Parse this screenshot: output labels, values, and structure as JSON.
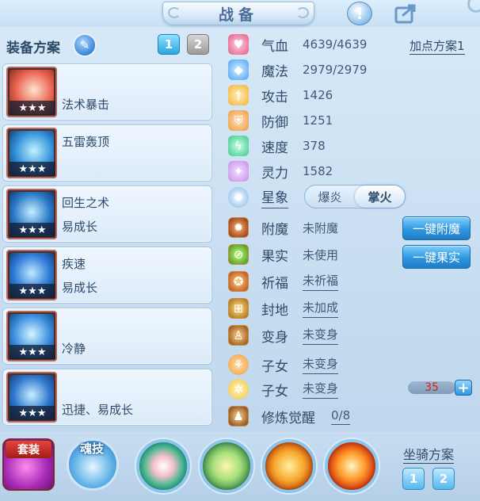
{
  "header": {
    "title": "战备",
    "help_icon": "exclamation-icon",
    "share_icon": "share-icon"
  },
  "equip_plan": {
    "label": "装备方案",
    "tabs": [
      "1",
      "2"
    ],
    "active_tab": "1",
    "items": [
      {
        "skill1": "",
        "skill2": "法术暴击",
        "stars": "★★★",
        "color": "#6fcf5a"
      },
      {
        "skill1": "五雷轰顶",
        "skill2": "",
        "stars": "★★★",
        "color": "#3a7fd8"
      },
      {
        "skill1": "回生之术",
        "skill2": "易成长",
        "stars": "★★★",
        "color": "#2f6fc2"
      },
      {
        "skill1": "疾速",
        "skill2": "易成长",
        "stars": "★★★",
        "color": "#2d7ad8"
      },
      {
        "skill1": "",
        "skill2": "冷静",
        "stars": "★★★",
        "color": "#3a8fe0"
      },
      {
        "skill1": "",
        "skill2": "迅捷、易成长",
        "stars": "★★★",
        "color": "#2f78cf"
      }
    ]
  },
  "stats": {
    "add_point_plan": "加点方案1",
    "rows": [
      {
        "name": "气血",
        "value": "4639/4639",
        "icon": "heart-icon",
        "color": "#e25a86"
      },
      {
        "name": "魔法",
        "value": "2979/2979",
        "icon": "mana-icon",
        "color": "#4aa3f0"
      },
      {
        "name": "攻击",
        "value": "1426",
        "icon": "sword-icon",
        "color": "#f2b233"
      },
      {
        "name": "防御",
        "value": "1251",
        "icon": "shield-icon",
        "color": "#ef9a3c"
      },
      {
        "name": "速度",
        "value": "378",
        "icon": "speed-icon",
        "color": "#3cc88a"
      },
      {
        "name": "灵力",
        "value": "1582",
        "icon": "spirit-icon",
        "color": "#c58de6"
      }
    ],
    "star_sign": {
      "name": "星象",
      "options": [
        "爆炎",
        "掌火"
      ],
      "selected": "掌火"
    },
    "extras": [
      {
        "name": "附魔",
        "value": "未附魔",
        "icon": "enchant-icon",
        "button": "一键附魔"
      },
      {
        "name": "果实",
        "value": "未使用",
        "icon": "fruit-icon",
        "button": "一键果实"
      },
      {
        "name": "祈福",
        "value": "未祈福",
        "icon": "blessing-icon"
      },
      {
        "name": "封地",
        "value": "未加成",
        "icon": "fief-icon"
      },
      {
        "name": "变身",
        "value": "未变身",
        "icon": "transform-icon"
      },
      {
        "name": "子女",
        "value": "未变身",
        "icon": "child-icon"
      },
      {
        "name": "子女",
        "value": "未变身",
        "icon": "child-icon"
      },
      {
        "name": "修炼觉醒",
        "value": "0/8",
        "icon": "cultivation-icon"
      }
    ],
    "child_level": "35"
  },
  "bottom": {
    "suit_label": "套装",
    "soul_label": "魂技",
    "mount_plan_label": "坐骑方案",
    "mount_tabs": [
      "1",
      "2"
    ]
  }
}
